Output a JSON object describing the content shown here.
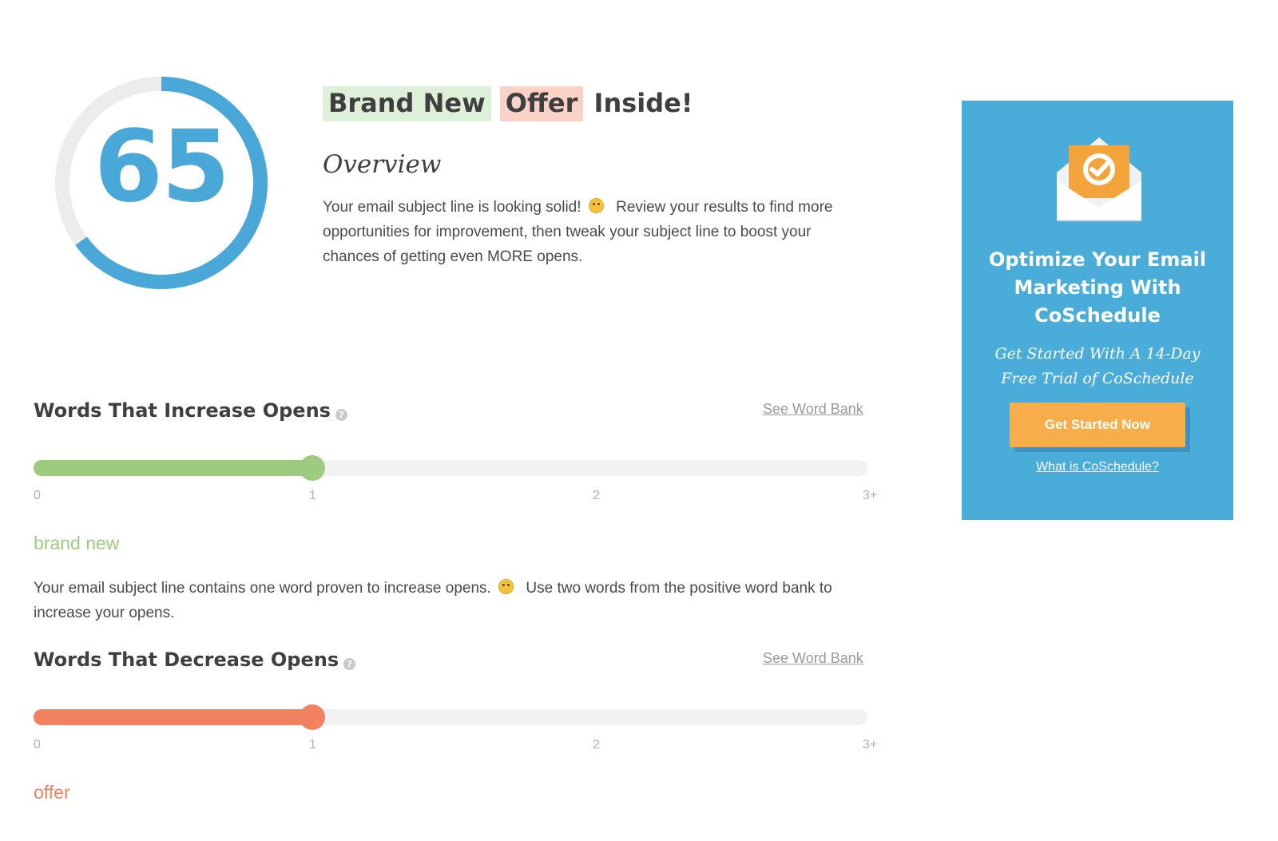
{
  "score": {
    "value": "65",
    "fraction": 0.65,
    "color": "#4aa8d8",
    "track_color": "#ececec"
  },
  "subject_line": {
    "word_positive": "Brand New",
    "word_negative": "Offer",
    "word_plain": "Inside!"
  },
  "overview": {
    "title": "Overview",
    "text_before_emoji": "Your email subject line is looking solid!",
    "emoji_icon": "smiling-face-icon",
    "text_after_emoji": "Review your results to find more opportunities for improvement, then tweak your subject line to boost your chances of getting even MORE opens."
  },
  "increase_section": {
    "title": "Words That Increase Opens",
    "help_label": "?",
    "word_bank_link": "See Word Bank",
    "ticks": [
      "0",
      "1",
      "2",
      "3+"
    ],
    "value": 1,
    "max": 3,
    "color": "#9dcb7f",
    "found_word": "brand new",
    "description_before_emoji": "Your email subject line contains one word proven to increase opens.",
    "emoji_icon": "thinking-face-icon",
    "description_after_emoji": "Use two words from the positive word bank to increase your opens."
  },
  "decrease_section": {
    "title": "Words That Decrease Opens",
    "help_label": "?",
    "word_bank_link": "See Word Bank",
    "ticks": [
      "0",
      "1",
      "2",
      "3+"
    ],
    "value": 1,
    "max": 3,
    "color": "#f0825f",
    "found_word": "offer"
  },
  "ad": {
    "background_color": "#4aadd9",
    "icon": "coschedule-envelope-icon",
    "title": "Optimize Your Email Marketing With CoSchedule",
    "subtitle": "Get Started With A 14-Day Free Trial of CoSchedule",
    "button_label": "Get Started Now",
    "button_color": "#f7ae4a",
    "link_label": "What is CoSchedule?"
  }
}
